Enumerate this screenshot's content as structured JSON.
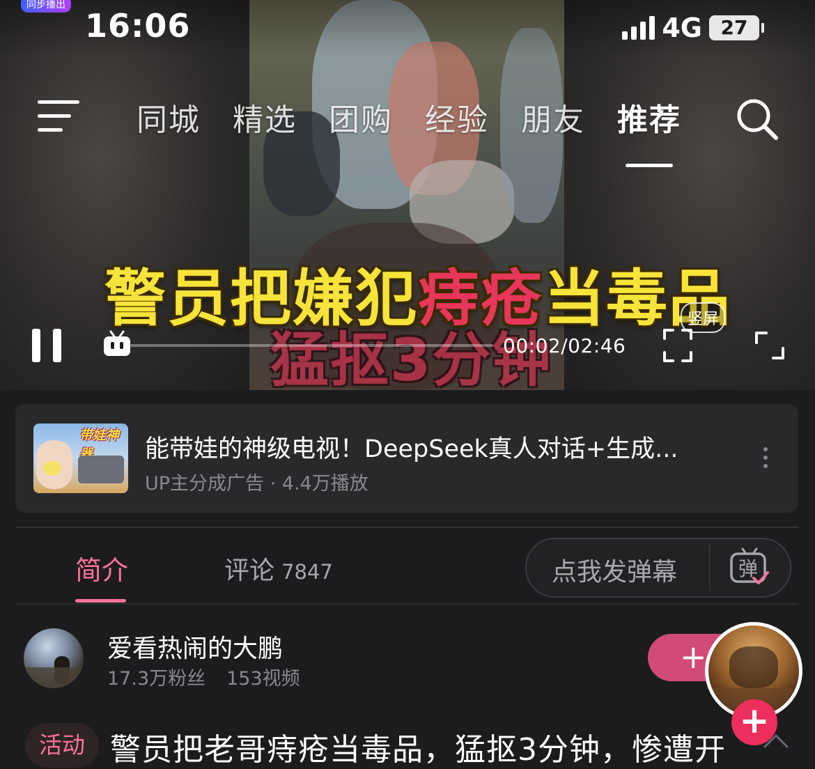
{
  "status_bar": {
    "time": "16:06",
    "network": "4G",
    "battery": "27",
    "app_badge": "同步播出"
  },
  "nav": {
    "tabs": [
      {
        "label": "同城"
      },
      {
        "label": "精选"
      },
      {
        "label": "团购"
      },
      {
        "label": "经验"
      },
      {
        "label": "朋友"
      },
      {
        "label": "推荐"
      }
    ],
    "active_index": 5
  },
  "video": {
    "caption_part1": "警员把嫌犯",
    "caption_highlight": "痔疮",
    "caption_part3": "当毒品",
    "caption_line2": "猛抠3分钟",
    "portrait_badge": "竖屏",
    "time": "00:02/02:46",
    "progress": 0.012
  },
  "ad": {
    "title": "能带娃的神级电视！DeepSeek真人对话+生成...",
    "subtitle": "UP主分成广告 · 4.4万播放",
    "thumb_text": "带娃神器"
  },
  "tabs": {
    "intro": "简介",
    "comments": "评论",
    "comments_count": "7847",
    "danmaku_placeholder": "点我发弹幕",
    "danmaku_icon_text": "弹"
  },
  "uploader": {
    "name": "爱看热闹的大鹏",
    "followers": "17.3万粉丝",
    "videos": "153视频",
    "follow_label": "+"
  },
  "video_info": {
    "tag": "活动",
    "title": "警员把老哥痔疮当毒品，猛抠3分钟，惨遭开"
  },
  "colors": {
    "accent": "#fb7299",
    "caption_yellow": "#f7e43a",
    "caption_red": "#e8365a",
    "background": "#1c1c1e"
  }
}
